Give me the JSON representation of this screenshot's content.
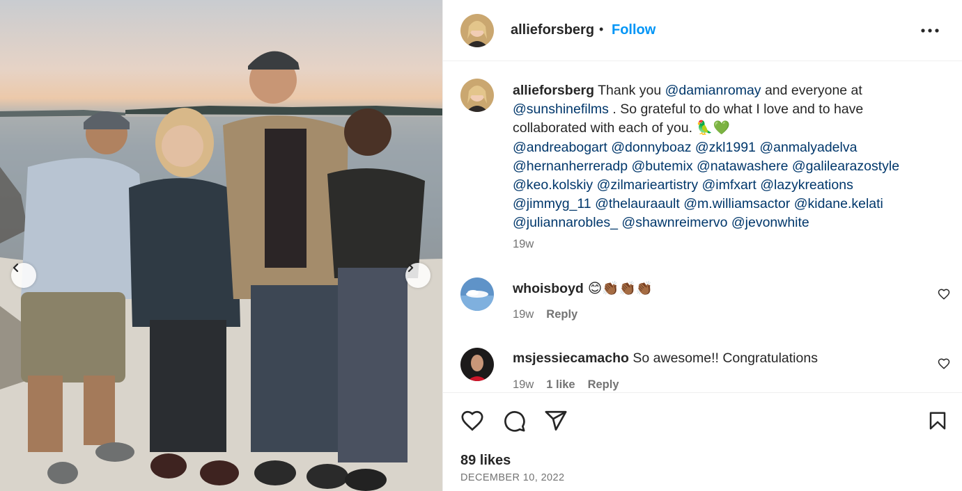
{
  "post": {
    "username": "allieforsberg",
    "dot": "•",
    "follow_label": "Follow",
    "caption": {
      "username": "allieforsberg",
      "text_1": "Thank you ",
      "mention_1": "@damianromay",
      "text_2": " and everyone at ",
      "mention_2": "@sunshinefilms",
      "text_3": " . So grateful to do what I love and to have collaborated with each of you. ",
      "emoji": "🦜💚",
      "mentions": [
        "@andreabogart",
        "@donnyboaz",
        "@zkl1991",
        "@anmalyadelva",
        "@hernanherreradp",
        "@butemix",
        "@natawashere",
        "@galilearazostyle",
        "@keo.kolskiy",
        "@zilmarieartistry",
        "@imfxart",
        "@lazykreations",
        "@jimmyg_11",
        "@thelauraault",
        "@m.williamsactor",
        "@kidane.kelati",
        "@juliannarobles_",
        "@shawnreimervo",
        "@jevonwhite"
      ],
      "timestamp": "19w"
    },
    "comments": [
      {
        "username": "whoisboyd",
        "text": "😊👏🏾👏🏾👏🏾",
        "timestamp": "19w",
        "reply_label": "Reply"
      },
      {
        "username": "msjessiecamacho",
        "text": "So awesome!! Congratulations",
        "timestamp": "19w",
        "likes_label": "1 like",
        "reply_label": "Reply"
      }
    ],
    "likes": "89 likes",
    "date": "DECEMBER 10, 2022"
  },
  "icons": {
    "prev": "chevron-left-icon",
    "next": "chevron-right-icon",
    "more": "more-horizontal-icon",
    "like": "heart-icon",
    "comment": "comment-icon",
    "share": "send-icon",
    "save": "bookmark-icon"
  },
  "colors": {
    "accent": "#0095f6",
    "mention": "#00376b",
    "muted": "#737373",
    "text": "#262626"
  }
}
